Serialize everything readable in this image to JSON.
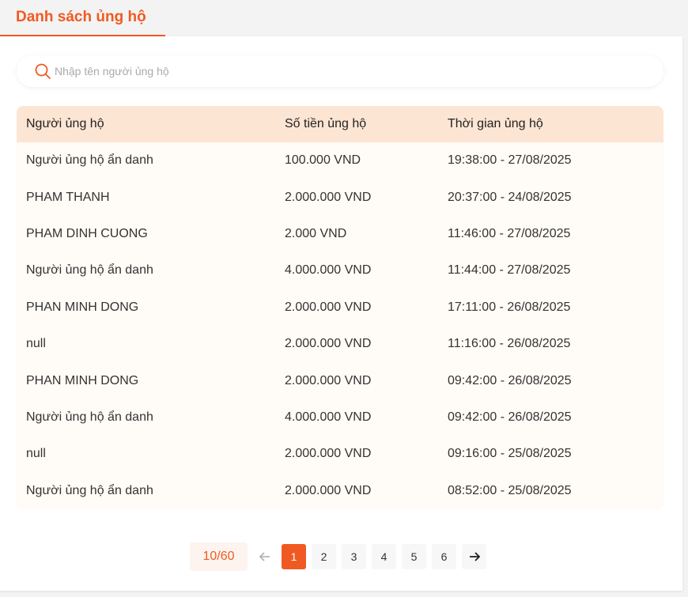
{
  "tab": {
    "label": "Danh sách ủng hộ"
  },
  "search": {
    "placeholder": "Nhập tên người ủng hộ"
  },
  "table": {
    "headers": [
      "Người ủng hộ",
      "Số tiền ủng hộ",
      "Thời gian ủng hộ"
    ],
    "rows": [
      [
        "Người ủng hộ ẩn danh",
        "100.000 VND",
        "19:38:00 - 27/08/2025"
      ],
      [
        "PHAM THANH",
        "2.000.000 VND",
        "20:37:00 - 24/08/2025"
      ],
      [
        "PHAM DINH CUONG",
        "2.000 VND",
        "11:46:00 - 27/08/2025"
      ],
      [
        "Người ủng hộ ẩn danh",
        "4.000.000 VND",
        "11:44:00 - 27/08/2025"
      ],
      [
        "PHAN MINH DONG",
        "2.000.000 VND",
        "17:11:00 - 26/08/2025"
      ],
      [
        "null",
        "2.000.000 VND",
        "11:16:00 - 26/08/2025"
      ],
      [
        "PHAN MINH DONG",
        "2.000.000 VND",
        "09:42:00 - 26/08/2025"
      ],
      [
        "Người ủng hộ ẩn danh",
        "4.000.000 VND",
        "09:42:00 - 26/08/2025"
      ],
      [
        "null",
        "2.000.000 VND",
        "09:16:00 - 25/08/2025"
      ],
      [
        "Người ủng hộ ẩn danh",
        "2.000.000 VND",
        "08:52:00 - 25/08/2025"
      ]
    ]
  },
  "pagination": {
    "count_label": "10/60",
    "pages": [
      "1",
      "2",
      "3",
      "4",
      "5",
      "6"
    ],
    "current_page": "1",
    "prev_icon": "arrow-left-icon",
    "next_icon": "arrow-right-icon"
  },
  "colors": {
    "accent": "#f05a22",
    "header_bg": "#fde5d4",
    "row_bg": "#fffbf6"
  },
  "icons": {
    "search": "search-icon"
  }
}
